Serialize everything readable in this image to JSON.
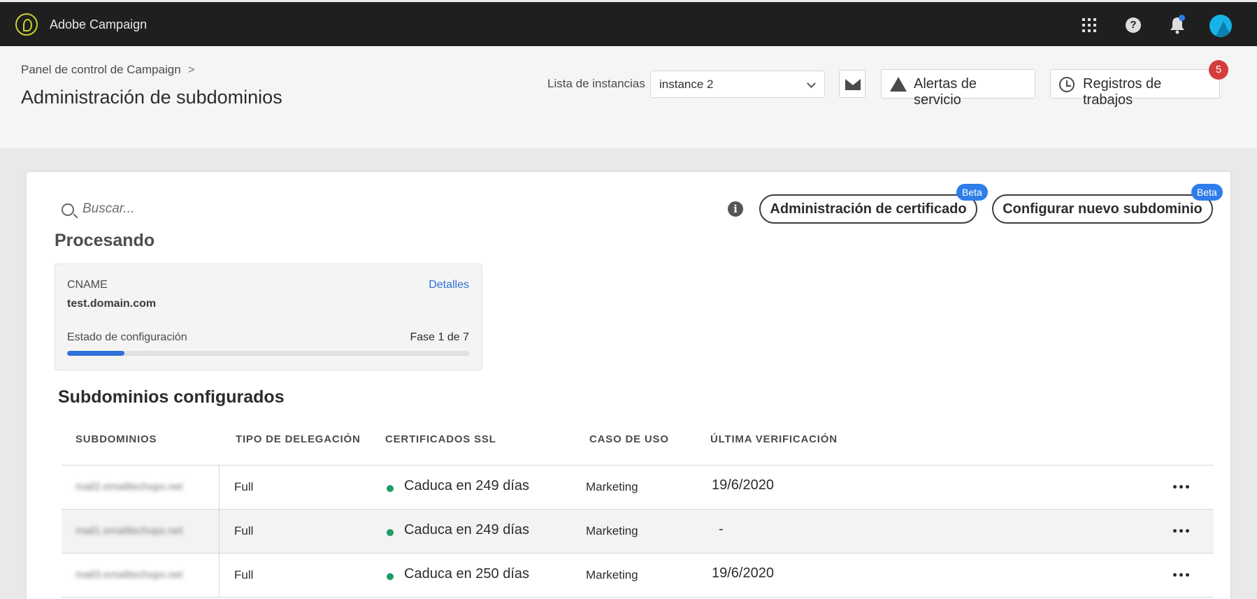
{
  "app": {
    "name": "Adobe Campaign"
  },
  "topbar": {
    "icons": [
      "apps-grid-icon",
      "help-icon",
      "bell-icon",
      "avatar"
    ],
    "help_glyph": "?"
  },
  "header": {
    "breadcrumb": "Panel de control de Campaign",
    "breadcrumb_sep": ">",
    "title": "Administración de subdominios",
    "instance_label": "Lista de instancias",
    "instance_value": "instance 2",
    "alerts_label": "Alertas de servicio",
    "logs_label": "Registros de trabajos",
    "logs_badge": "5"
  },
  "toolbar": {
    "search_placeholder": "Buscar...",
    "info_glyph": "i",
    "cert_button": "Administración de certificado",
    "cert_badge": "Beta",
    "new_subdomain_button": "Configurar nuevo subdominio",
    "new_subdomain_badge": "Beta"
  },
  "processing": {
    "title": "Procesando",
    "cname_label": "CNAME",
    "details_link": "Detalles",
    "domain": "test.domain.com",
    "status_label": "Estado de configuración",
    "phase": "Fase 1 de 7",
    "progress_fraction": 0.143
  },
  "configured": {
    "title": "Subdominios configurados",
    "columns": [
      "SUBDOMINIOS",
      "TIPO DE DELEGACIÓN",
      "CERTIFICADOS SSL",
      "CASO DE USO",
      "ÚLTIMA VERIFICACIÓN"
    ],
    "rows": [
      {
        "subdomain": "mail2.emailtechops.net",
        "type": "Full",
        "ssl": "Caduca en 249 días",
        "use": "Marketing",
        "verified": "19/6/2020"
      },
      {
        "subdomain": "mail1.emailtechops.net",
        "type": "Full",
        "ssl": "Caduca en 249 días",
        "use": "Marketing",
        "verified": "-"
      },
      {
        "subdomain": "mail3.emailtechops.net",
        "type": "Full",
        "ssl": "Caduca en 250 días",
        "use": "Marketing",
        "verified": "19/6/2020"
      }
    ]
  },
  "colors": {
    "accent": "#2f72d9",
    "ssl_ok": "#1f9c62",
    "badge": "#d43d3d",
    "topbar": "#1f1f1f"
  }
}
